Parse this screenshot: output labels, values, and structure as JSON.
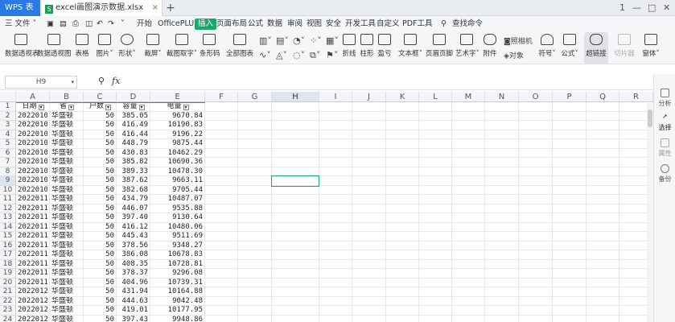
{
  "app": {
    "name": "WPS 表格",
    "file_tab": "excel画图演示数据.xlsx",
    "add_tab": "+"
  },
  "window": {
    "restore": "1",
    "minimize": "—",
    "maximize": "□",
    "close": "✕"
  },
  "menu": {
    "file": "三 文件 ˅",
    "items": [
      "开始",
      "OfficePLUS",
      "插入",
      "页面布局",
      "公式",
      "数据",
      "审阅",
      "视图",
      "安全",
      "开发工具",
      "自定义",
      "PDF工具"
    ],
    "active": "插入",
    "search": "查找命令"
  },
  "toolbar": [
    {
      "label": "数据透视表",
      "icon": "pivot-table-icon"
    },
    {
      "label": "数据透视图",
      "icon": "pivot-chart-icon"
    },
    {
      "label": "表格",
      "icon": "table-icon"
    },
    {
      "label": "图片˅",
      "icon": "picture-icon"
    },
    {
      "label": "形状˅",
      "icon": "shape-icon"
    },
    {
      "label": "截屏˅",
      "icon": "screenshot-icon"
    },
    {
      "label": "截图取字˅",
      "icon": "ocr-icon"
    },
    {
      "label": "条形码",
      "icon": "barcode-icon"
    },
    {
      "label": "全部图表",
      "icon": "all-charts-icon"
    },
    {
      "label": "折线",
      "icon": "line-chart-icon"
    },
    {
      "label": "柱形",
      "icon": "column-chart-icon"
    },
    {
      "label": "盈亏",
      "icon": "winloss-icon"
    },
    {
      "label": "文本框˅",
      "icon": "textbox-icon"
    },
    {
      "label": "页眉页脚",
      "icon": "header-footer-icon"
    },
    {
      "label": "艺术字˅",
      "icon": "wordart-icon"
    },
    {
      "label": "附件",
      "icon": "attachment-icon"
    },
    {
      "label": "符号˅",
      "icon": "symbol-icon"
    },
    {
      "label": "公式˅",
      "icon": "formula-icon"
    },
    {
      "label": "超链接",
      "icon": "hyperlink-icon"
    },
    {
      "label": "切片器",
      "icon": "slicer-icon"
    },
    {
      "label": "窗体˅",
      "icon": "form-icon"
    }
  ],
  "toolbar_small": [
    "照相机",
    "对象"
  ],
  "formula_bar": {
    "name_box": "H9",
    "fx": "fx"
  },
  "columns": [
    "A",
    "B",
    "C",
    "D",
    "E",
    "F",
    "G",
    "H",
    "I",
    "J",
    "K",
    "L",
    "M",
    "N",
    "O",
    "P",
    "Q",
    "R"
  ],
  "selected_column": "H",
  "selected_row": "9",
  "headers": [
    "日期",
    "省",
    "户数",
    "容量",
    "电量"
  ],
  "rows": [
    [
      "20220101",
      "华盛顿",
      "50",
      "385.05",
      "9670.84"
    ],
    [
      "20220102",
      "华盛顿",
      "50",
      "416.49",
      "10190.83"
    ],
    [
      "20220103",
      "华盛顿",
      "50",
      "416.44",
      "9196.22"
    ],
    [
      "20220104",
      "华盛顿",
      "50",
      "448.79",
      "9875.44"
    ],
    [
      "20220105",
      "华盛顿",
      "50",
      "430.83",
      "10462.29"
    ],
    [
      "20220106",
      "华盛顿",
      "50",
      "385.82",
      "10690.36"
    ],
    [
      "20220107",
      "华盛顿",
      "50",
      "389.33",
      "10478.30"
    ],
    [
      "20220108",
      "华盛顿",
      "50",
      "387.62",
      "9663.11"
    ],
    [
      "20220109",
      "华盛顿",
      "50",
      "382.68",
      "9705.44"
    ],
    [
      "20220110",
      "华盛顿",
      "50",
      "434.79",
      "10487.07"
    ],
    [
      "20220111",
      "华盛顿",
      "50",
      "446.07",
      "9535.88"
    ],
    [
      "20220112",
      "华盛顿",
      "50",
      "397.40",
      "9130.64"
    ],
    [
      "20220113",
      "华盛顿",
      "50",
      "416.12",
      "10480.06"
    ],
    [
      "20220114",
      "华盛顿",
      "50",
      "445.43",
      "9511.69"
    ],
    [
      "20220115",
      "华盛顿",
      "50",
      "378.56",
      "9348.27"
    ],
    [
      "20220116",
      "华盛顿",
      "50",
      "386.08",
      "10678.83"
    ],
    [
      "20220117",
      "华盛顿",
      "50",
      "408.35",
      "10728.81"
    ],
    [
      "20220118",
      "华盛顿",
      "50",
      "378.37",
      "9296.08"
    ],
    [
      "20220119",
      "华盛顿",
      "50",
      "404.96",
      "10739.31"
    ],
    [
      "20220120",
      "华盛顿",
      "50",
      "431.94",
      "10164.88"
    ],
    [
      "20220121",
      "华盛顿",
      "50",
      "444.63",
      "9042.48"
    ],
    [
      "20220122",
      "华盛顿",
      "50",
      "419.01",
      "10177.95"
    ],
    [
      "20220123",
      "华盛顿",
      "50",
      "397.43",
      "9948.86"
    ]
  ],
  "right_panel": [
    "分析",
    "选择",
    "属性",
    "备份"
  ]
}
